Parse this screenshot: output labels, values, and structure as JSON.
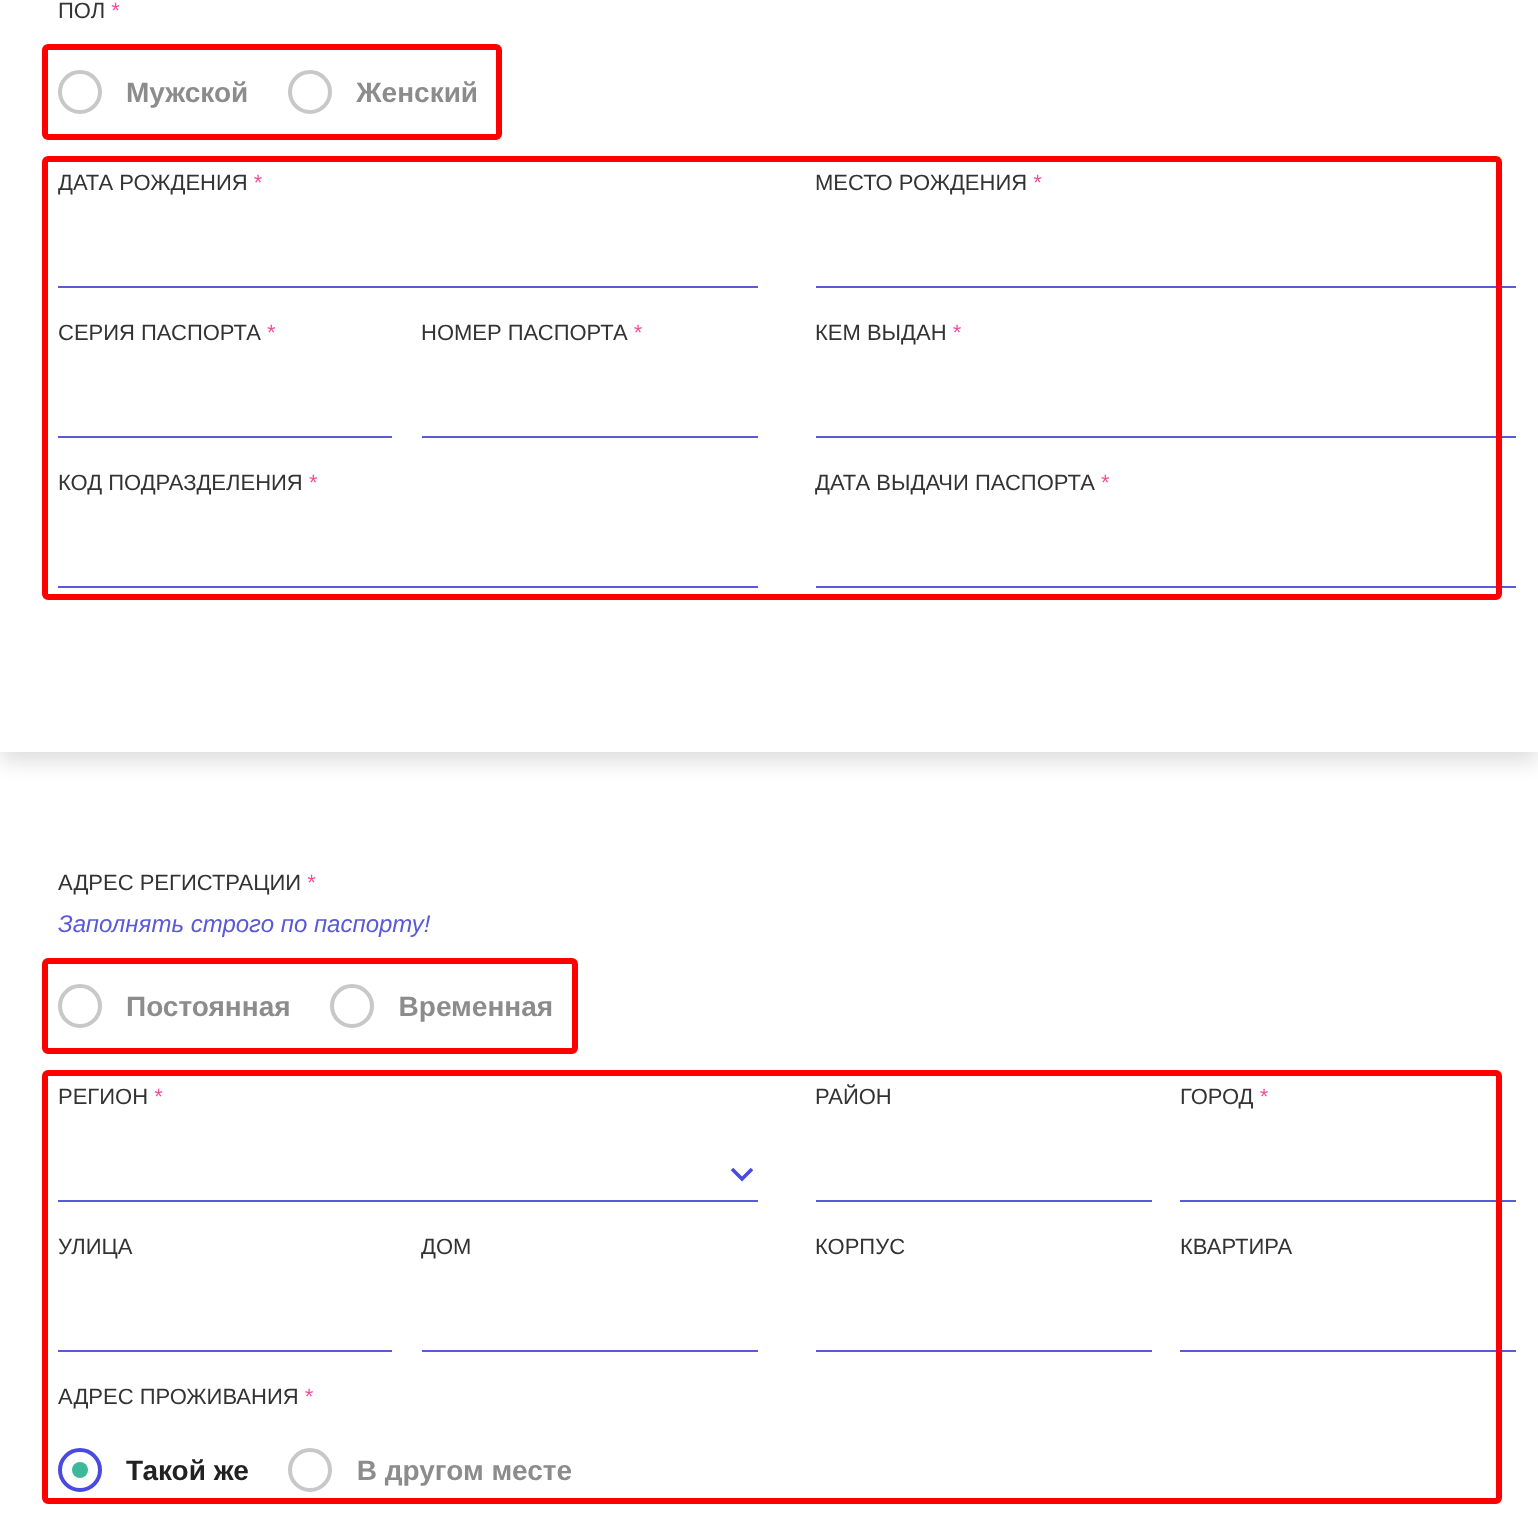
{
  "cards": [
    {
      "groups": [
        {
          "kind": "radio",
          "label": "ПОЛ",
          "required_mark": "*",
          "highlighted": true,
          "options": [
            {
              "label": "Мужской",
              "selected": false
            },
            {
              "label": "Женский",
              "selected": false
            }
          ]
        },
        {
          "kind": "fields",
          "highlighted": true,
          "fields": [
            {
              "kind": "text",
              "wide": true,
              "label": "ДАТА РОЖДЕНИЯ",
              "required_mark": "*"
            },
            {
              "kind": "text",
              "wide": true,
              "label": "МЕСТО РОЖДЕНИЯ",
              "required_mark": "*"
            },
            {
              "kind": "text",
              "wide": false,
              "label": "СЕРИЯ ПАСПОРТА",
              "required_mark": "*"
            },
            {
              "kind": "text",
              "wide": false,
              "label": "НОМЕР ПАСПОРТА",
              "required_mark": "*"
            },
            {
              "kind": "text",
              "wide": true,
              "label": "КЕМ ВЫДАН",
              "required_mark": "*"
            },
            {
              "kind": "text",
              "wide": true,
              "label": "КОД ПОДРАЗДЕЛЕНИЯ",
              "required_mark": "*"
            },
            {
              "kind": "text",
              "wide": true,
              "label": "ДАТА ВЫДАЧИ ПАСПОРТА",
              "required_mark": "*"
            }
          ]
        }
      ]
    },
    {
      "groups": [
        {
          "kind": "radio",
          "label": "АДРЕС РЕГИСТРАЦИИ",
          "required_mark": "*",
          "note": "Заполнять строго по паспорту!",
          "highlighted": true,
          "options": [
            {
              "label": "Постоянная",
              "selected": false
            },
            {
              "label": "Временная",
              "selected": false
            }
          ]
        },
        {
          "kind": "fields",
          "highlighted": true,
          "fields": [
            {
              "kind": "select",
              "wide": true,
              "label": "РЕГИОН",
              "required_mark": "*"
            },
            {
              "kind": "text",
              "wide": false,
              "label": "РАЙОН"
            },
            {
              "kind": "text",
              "wide": false,
              "label": "ГОРОД",
              "required_mark": "*"
            },
            {
              "kind": "text",
              "wide": false,
              "label": "УЛИЦА"
            },
            {
              "kind": "text",
              "wide": false,
              "label": "ДОМ"
            },
            {
              "kind": "text",
              "wide": false,
              "label": "КОРПУС"
            },
            {
              "kind": "text",
              "wide": false,
              "label": "КВАРТИРА"
            },
            {
              "kind": "radio",
              "label": "АДРЕС ПРОЖИВАНИЯ",
              "required_mark": "*",
              "options": [
                {
                  "label": "Такой же",
                  "selected": true
                },
                {
                  "label": "В другом месте",
                  "selected": false
                }
              ]
            }
          ]
        }
      ]
    }
  ]
}
